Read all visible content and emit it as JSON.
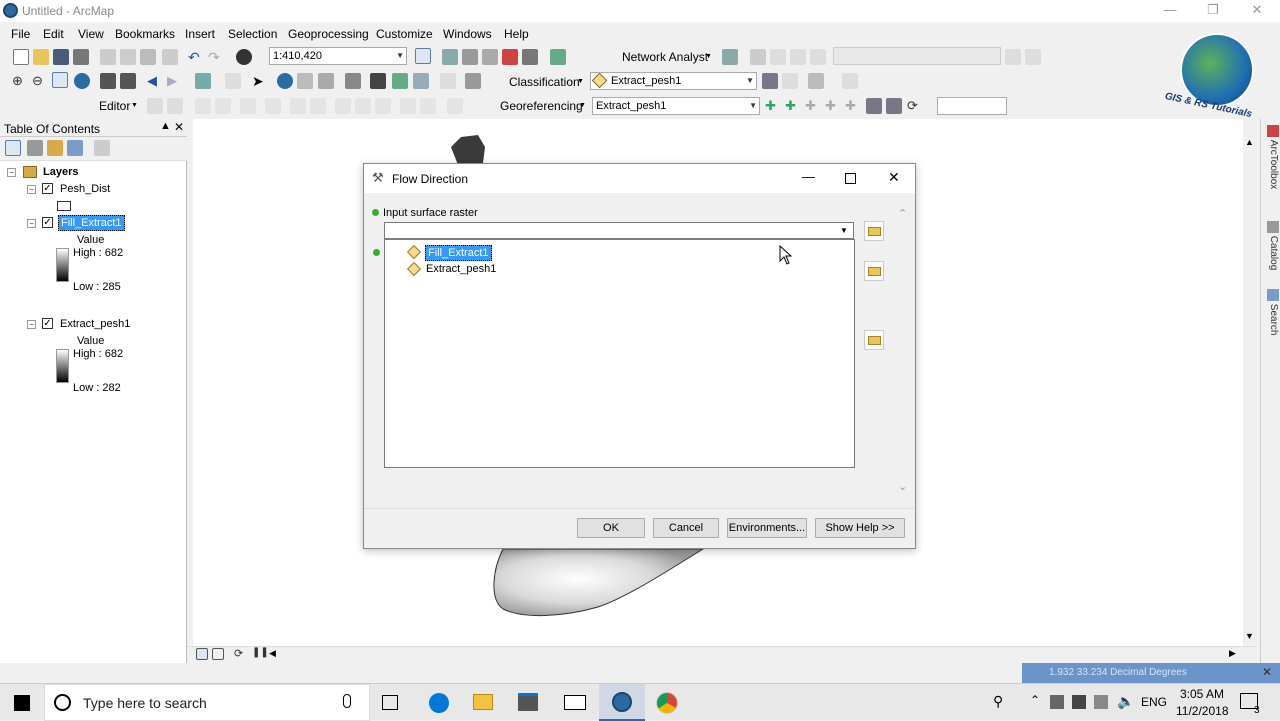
{
  "window": {
    "title": "Untitled - ArcMap"
  },
  "menu": [
    "File",
    "Edit",
    "View",
    "Bookmarks",
    "Insert",
    "Selection",
    "Geoprocessing",
    "Customize",
    "Windows",
    "Help"
  ],
  "toolbar": {
    "scale": "1:410,420",
    "network_analyst": "Network Analyst",
    "classification": "Classification",
    "classification_layer": "Extract_pesh1",
    "editor": "Editor",
    "georeferencing": "Georeferencing",
    "georef_layer": "Extract_pesh1"
  },
  "watermark": "GIS & RS Tutorials",
  "toc": {
    "title": "Table Of Contents",
    "root": "Layers",
    "layers": [
      {
        "name": "Pesh_Dist"
      },
      {
        "name": "Fill_Extract1",
        "legend_title": "Value",
        "high": "High : 682",
        "low": "Low : 285"
      },
      {
        "name": "Extract_pesh1",
        "legend_title": "Value",
        "high": "High : 682",
        "low": "Low : 282"
      }
    ]
  },
  "right_dock": [
    "ArcToolbox",
    "Catalog",
    "Search"
  ],
  "status": {
    "coords": "1.932  33.234 Decimal Degrees"
  },
  "dialog": {
    "title": "Flow Direction",
    "label": "Input surface raster",
    "input_value": "",
    "options": [
      "Fill_Extract1",
      "Extract_pesh1"
    ],
    "buttons": {
      "ok": "OK",
      "cancel": "Cancel",
      "env": "Environments...",
      "help": "Show Help >>"
    }
  },
  "taskbar": {
    "search_placeholder": "Type here to search",
    "language": "ENG",
    "time": "3:05 AM",
    "date": "11/2/2018",
    "notifications": "3"
  }
}
